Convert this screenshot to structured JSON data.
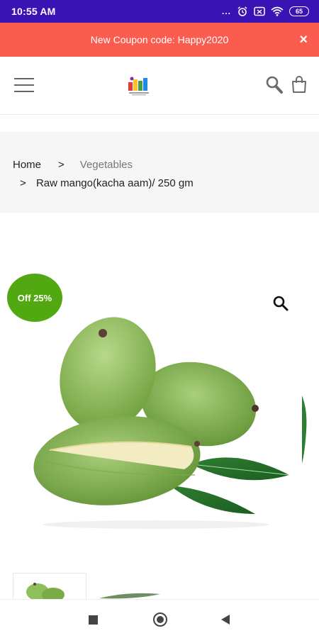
{
  "status_bar": {
    "time": "10:55 AM",
    "dots": "...",
    "battery": "65",
    "icons": [
      "alarm-icon",
      "screen-icon",
      "wifi-icon",
      "battery-icon"
    ]
  },
  "coupon_bar": {
    "text": "New Coupon code: Happy2020",
    "close_symbol": "×"
  },
  "header": {
    "icons": [
      "menu-icon",
      "logo",
      "search-icon",
      "cart-icon"
    ]
  },
  "breadcrumb": {
    "home": "Home",
    "separator": ">",
    "category": "Vegetables",
    "current": "Raw mango(kacha aam)/ 250 gm"
  },
  "product": {
    "badge": "Off 25%",
    "zoom_icon": "zoom-icon"
  },
  "nav_bar": {
    "icons": [
      "recents-icon",
      "home-icon",
      "back-icon"
    ]
  },
  "colors": {
    "status_bar": "#3a13b5",
    "coupon_bar": "#fa5d4f",
    "sale_badge": "#52a811"
  }
}
